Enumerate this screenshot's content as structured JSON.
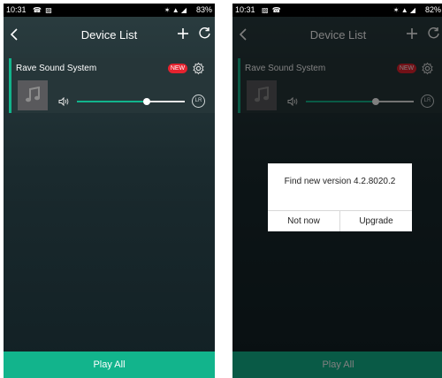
{
  "screens": [
    {
      "status": {
        "time": "10:31",
        "icons": "☎ ▨",
        "signal": "✶ ▲ ◢",
        "battery": "83%"
      },
      "header": {
        "title": "Device List"
      },
      "device": {
        "name": "Rave Sound System",
        "badge": "NEW",
        "volume": 0.65,
        "channel": "LR"
      },
      "footer": {
        "play_all": "Play All"
      }
    },
    {
      "status": {
        "time": "10:31",
        "icons": "▨ ☎",
        "signal": "✶ ▲ ◢",
        "battery": "82%"
      },
      "header": {
        "title": "Device List"
      },
      "device": {
        "name": "Rave Sound System",
        "badge": "NEW",
        "volume": 0.65,
        "channel": "LR"
      },
      "footer": {
        "play_all": "Play All"
      },
      "dialog": {
        "message": "Find new version  4.2.8020.2",
        "cancel": "Not now",
        "confirm": "Upgrade"
      }
    }
  ],
  "colors": {
    "accent": "#12b48c",
    "badge": "#e5232f",
    "background": "#1a2a2e"
  }
}
